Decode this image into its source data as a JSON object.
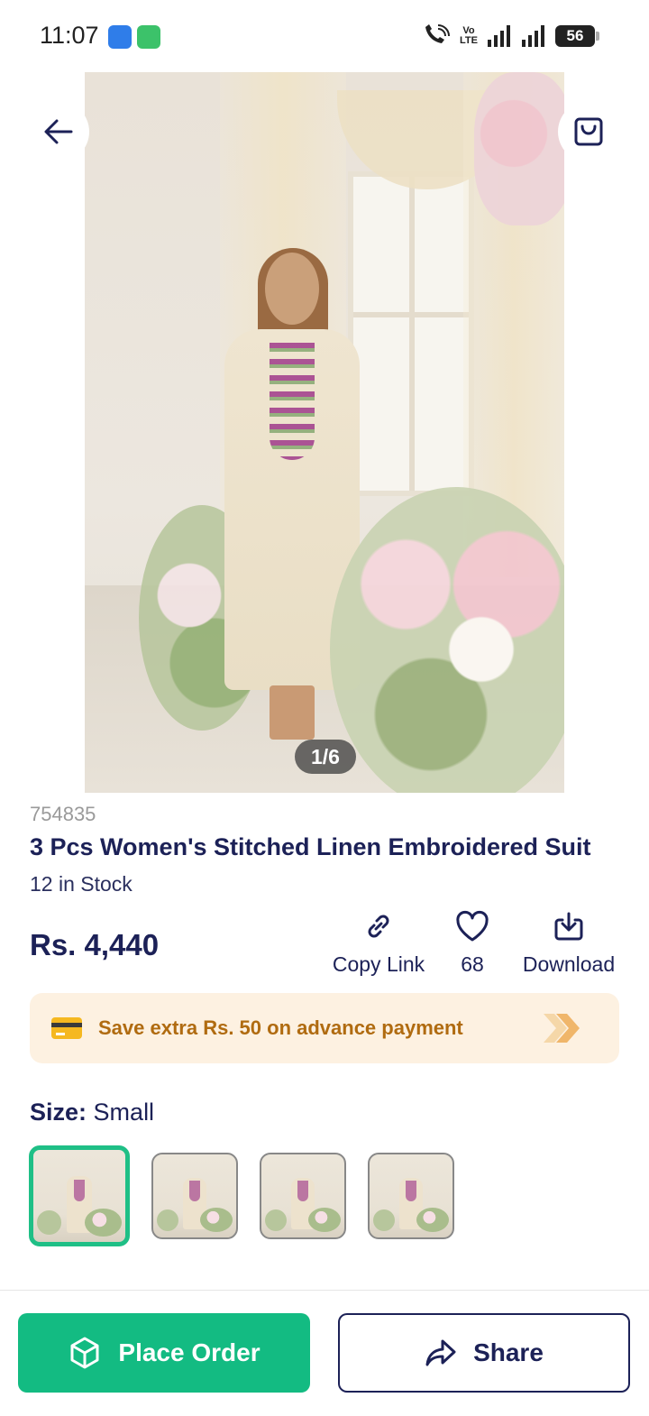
{
  "status_bar": {
    "time": "11:07",
    "volte_line1": "Vo",
    "volte_line2": "LTE",
    "battery": "56"
  },
  "gallery": {
    "counter": "1/6"
  },
  "product": {
    "sku": "754835",
    "title": "3 Pcs Women's Stitched Linen Embroidered Suit",
    "stock": "12 in Stock",
    "price": "Rs. 4,440"
  },
  "actions": {
    "copy_link": "Copy Link",
    "likes": "68",
    "download": "Download"
  },
  "promo": {
    "text": "Save extra Rs. 50 on advance payment"
  },
  "size": {
    "label": "Size:",
    "value": "Small"
  },
  "bottom": {
    "place_order": "Place Order",
    "share": "Share"
  },
  "colors": {
    "primary_green": "#13bb82",
    "navy": "#1c2157",
    "promo_bg": "#fdf1e1",
    "promo_text": "#b06b10"
  }
}
